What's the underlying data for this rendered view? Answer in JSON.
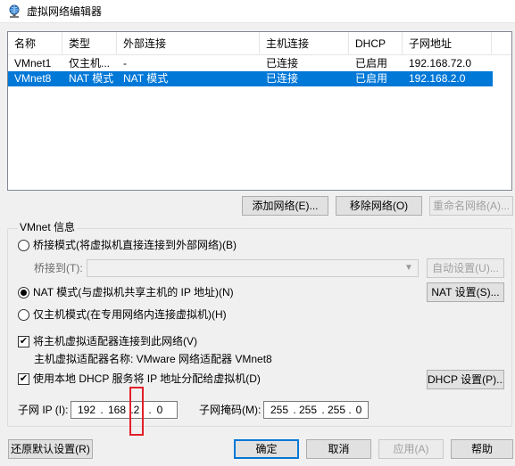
{
  "window": {
    "title": "虚拟网络编辑器",
    "icon": "network-globe-icon"
  },
  "table": {
    "headers": [
      "名称",
      "类型",
      "外部连接",
      "主机连接",
      "DHCP",
      "子网地址"
    ],
    "rows": [
      {
        "name": "VMnet1",
        "type": "仅主机...",
        "external": "-",
        "host": "已连接",
        "dhcp": "已启用",
        "subnet": "192.168.72.0",
        "selected": false
      },
      {
        "name": "VMnet8",
        "type": "NAT 模式",
        "external": "NAT 模式",
        "host": "已连接",
        "dhcp": "已启用",
        "subnet": "192.168.2.0",
        "selected": true
      }
    ]
  },
  "list_buttons": {
    "add": "添加网络(E)...",
    "remove": "移除网络(O)",
    "rename": "重命名网络(A)..."
  },
  "vmnet_info": {
    "group_title": "VMnet 信息",
    "bridge_mode": "桥接模式(将虚拟机直接连接到外部网络)(B)",
    "bridge_to_label": "桥接到(T):",
    "bridge_to_value": "",
    "auto_settings": "自动设置(U)...",
    "nat_mode": "NAT 模式(与虚拟机共享主机的 IP 地址)(N)",
    "nat_settings": "NAT 设置(S)...",
    "host_only_mode": "仅主机模式(在专用网络内连接虚拟机)(H)",
    "selected_mode": "nat",
    "connect_adapter": "将主机虚拟适配器连接到此网络(V)",
    "connect_adapter_checked": true,
    "adapter_name": "主机虚拟适配器名称: VMware 网络适配器 VMnet8",
    "use_dhcp": "使用本地 DHCP 服务将 IP 地址分配给虚拟机(D)",
    "use_dhcp_checked": true,
    "dhcp_settings": "DHCP 设置(P)...",
    "subnet_ip_label": "子网 IP (I):",
    "subnet_ip": [
      "192",
      "168",
      "2",
      "0"
    ],
    "subnet_mask_label": "子网掩码(M):",
    "subnet_mask": [
      "255",
      "255",
      "255",
      "0"
    ]
  },
  "footer": {
    "restore_defaults": "还原默认设置(R)",
    "ok": "确定",
    "cancel": "取消",
    "apply": "应用(A)",
    "help": "帮助"
  },
  "annotation": {
    "highlight_color": "#e21f2a"
  }
}
